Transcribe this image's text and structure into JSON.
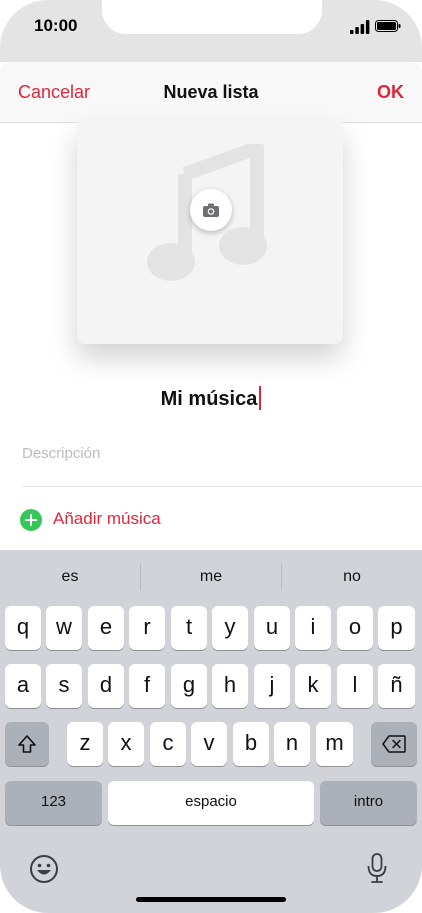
{
  "status_bar": {
    "time": "10:00"
  },
  "navbar": {
    "cancel": "Cancelar",
    "title": "Nueva lista",
    "ok": "OK"
  },
  "playlist": {
    "name": "Mi música",
    "description_placeholder": "Descripción",
    "add_music": "Añadir música"
  },
  "keyboard": {
    "suggestions": [
      "es",
      "me",
      "no"
    ],
    "row1": [
      "q",
      "w",
      "e",
      "r",
      "t",
      "y",
      "u",
      "i",
      "o",
      "p"
    ],
    "row2": [
      "a",
      "s",
      "d",
      "f",
      "g",
      "h",
      "j",
      "k",
      "l",
      "ñ"
    ],
    "row3": [
      "z",
      "x",
      "c",
      "v",
      "b",
      "n",
      "m"
    ],
    "numbers_label": "123",
    "space_label": "espacio",
    "return_label": "intro"
  },
  "icons": [
    "signal-icon",
    "battery-icon",
    "music-note-icon",
    "camera-icon",
    "add-icon",
    "shift-icon",
    "delete-icon",
    "emoji-icon",
    "microphone-icon"
  ],
  "colors": {
    "accent": "#e0263b",
    "add_green": "#34c759",
    "keyboard_bg": "#d1d3d9",
    "dark_key": "#acb1b9"
  }
}
